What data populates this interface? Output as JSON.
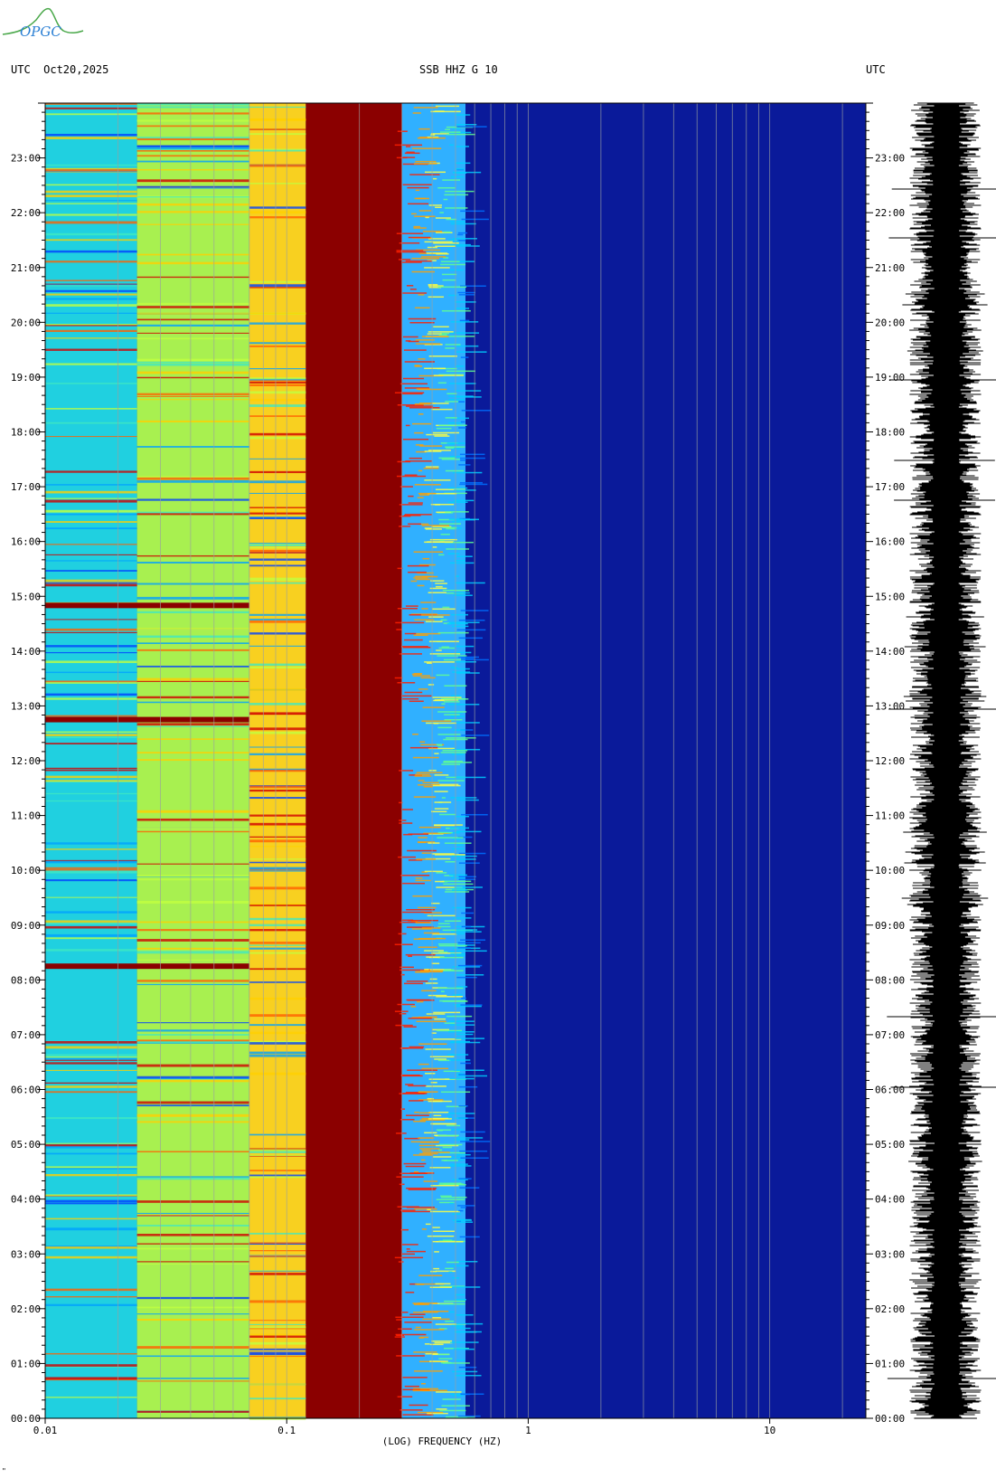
{
  "header": {
    "left": "UTC  Oct20,2025",
    "center": "SSB HHZ G 10",
    "right": "UTC"
  },
  "logo": {
    "text": "OPGC",
    "color": "#3a9a3a"
  },
  "corner_mark": "\"",
  "chart_data": {
    "type": "heatmap",
    "title": "SSB HHZ G 10",
    "date": "Oct20,2025",
    "xlabel": "(LOG) FREQUENCY (HZ)",
    "x_scale": "log",
    "xlim": [
      0.01,
      25
    ],
    "x_ticks": [
      {
        "value": 0.01,
        "label": "0.01"
      },
      {
        "value": 0.1,
        "label": "0.1"
      },
      {
        "value": 1,
        "label": "1"
      },
      {
        "value": 10,
        "label": "10"
      }
    ],
    "y_axis": "UTC time",
    "ylim_hours": [
      0,
      24
    ],
    "y_ticks": [
      "00:00",
      "01:00",
      "02:00",
      "03:00",
      "04:00",
      "05:00",
      "06:00",
      "07:00",
      "08:00",
      "09:00",
      "10:00",
      "11:00",
      "12:00",
      "13:00",
      "14:00",
      "15:00",
      "16:00",
      "17:00",
      "18:00",
      "19:00",
      "20:00",
      "21:00",
      "22:00",
      "23:00"
    ],
    "colormap": [
      "#00007f",
      "#0000ff",
      "#00c8ff",
      "#7dff7a",
      "#ffe600",
      "#ff4500",
      "#7f0000"
    ],
    "spectral_bands": [
      {
        "f_min": 0.01,
        "f_max": 0.024,
        "level": "cyan-green",
        "color": "#20d0e0"
      },
      {
        "f_min": 0.024,
        "f_max": 0.07,
        "level": "green-yellow",
        "color": "#a8f050"
      },
      {
        "f_min": 0.07,
        "f_max": 0.12,
        "level": "yellow-orange",
        "color": "#f8d020"
      },
      {
        "f_min": 0.12,
        "f_max": 0.3,
        "level": "saturated",
        "color": "#8b0000"
      },
      {
        "f_min": 0.3,
        "f_max": 0.55,
        "level": "decaying",
        "color": "#30b0ff"
      },
      {
        "f_min": 0.55,
        "f_max": 25,
        "level": "background",
        "color": "#0a1a9a"
      }
    ],
    "events_utc": [
      "12:45",
      "08:15",
      "14:50"
    ],
    "trace": "waveform (seismogram) over 24 h",
    "grid": true
  }
}
